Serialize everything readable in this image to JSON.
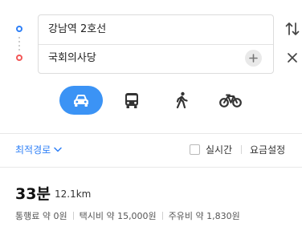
{
  "route": {
    "origin": "강남역 2호선",
    "destination": "국회의사당"
  },
  "modes": [
    {
      "name": "car",
      "icon": "car-icon",
      "active": true
    },
    {
      "name": "bus",
      "icon": "bus-icon",
      "active": false
    },
    {
      "name": "walk",
      "icon": "walk-icon",
      "active": false
    },
    {
      "name": "bike",
      "icon": "bike-icon",
      "active": false
    }
  ],
  "options": {
    "sort_label": "최적경로",
    "realtime_label": "실시간",
    "realtime_checked": false,
    "fare_settings_label": "요금설정"
  },
  "result": {
    "time": "33분",
    "distance": "12.1km",
    "toll": "통행료 약 0원",
    "taxi": "택시비 약 15,000원",
    "fuel": "주유비 약 1,830원"
  },
  "colors": {
    "accent": "#2f80f7",
    "active_mode_bg": "#3b93f5",
    "destination_marker": "#f25757"
  }
}
